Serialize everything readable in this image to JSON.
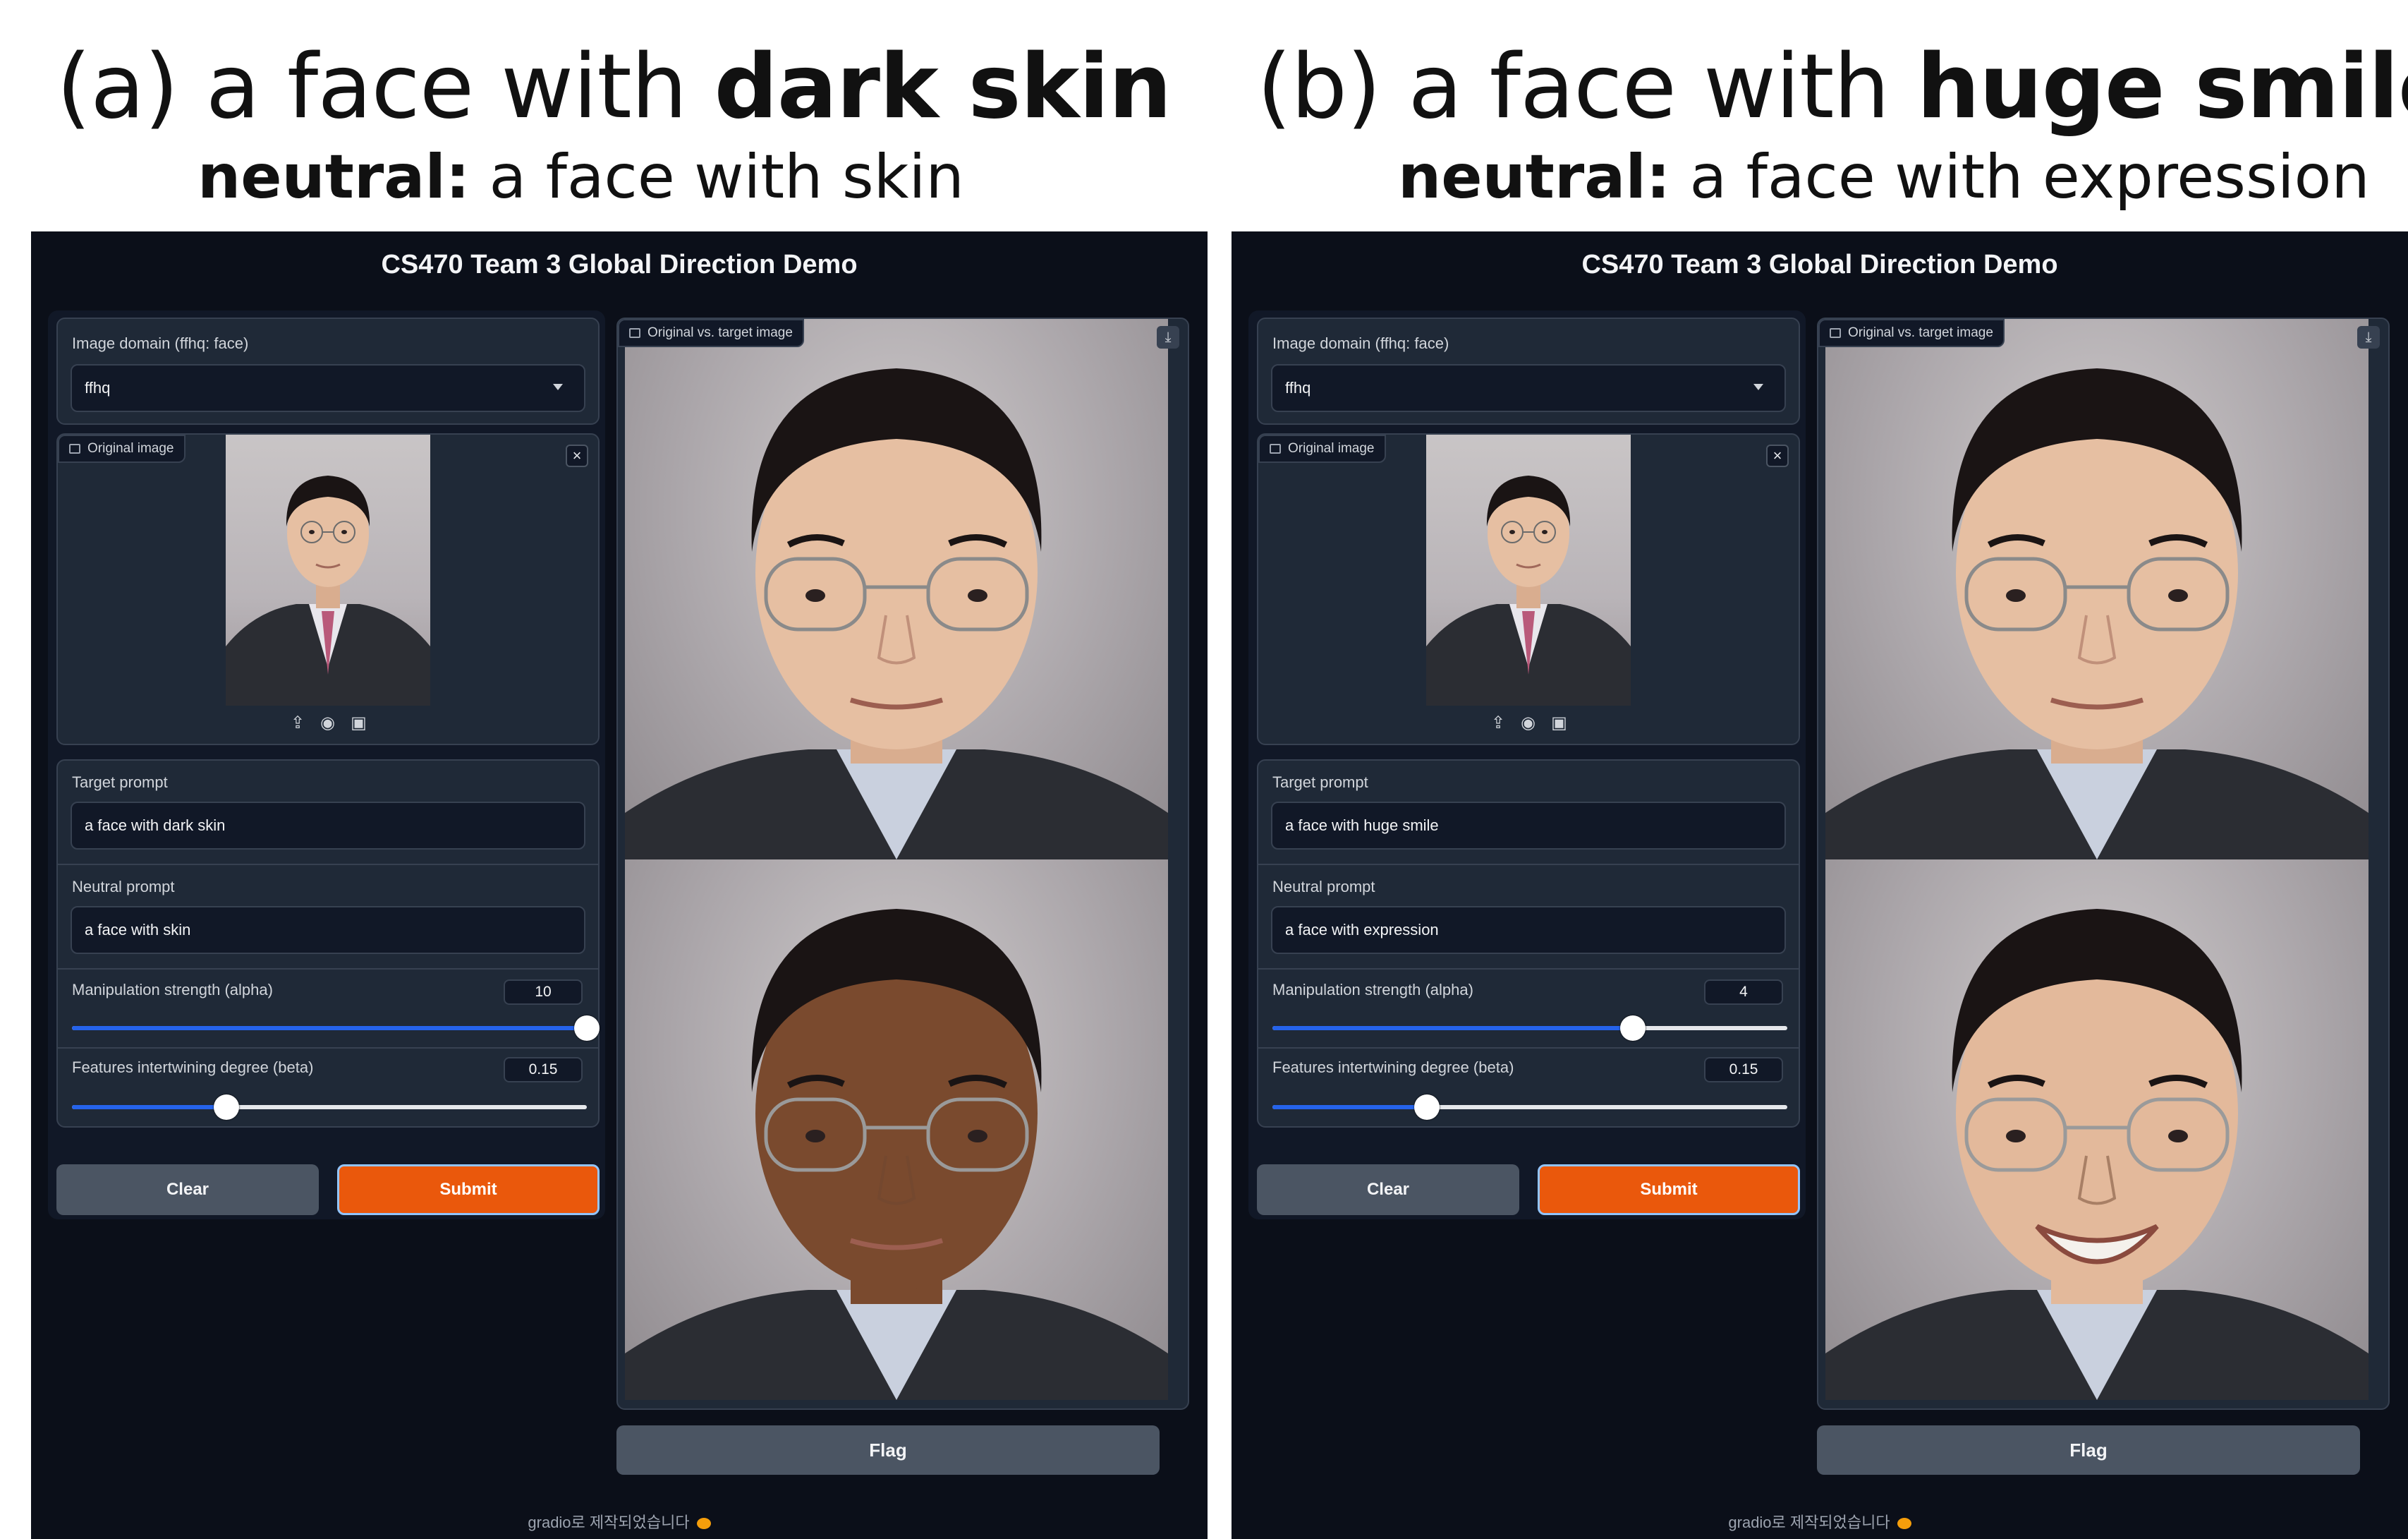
{
  "panels": [
    {
      "caption_prefix": "(a) a face with ",
      "caption_bold": "dark skin",
      "neutral_bold": "neutral:",
      "neutral_text": " a face with skin",
      "app_title": "CS470 Team 3 Global Direction Demo",
      "domain_label": "Image domain (ffhq: face)",
      "domain_value": "ffhq",
      "original_image_label": "Original image",
      "target_prompt_label": "Target prompt",
      "target_prompt_value": "a face with dark skin",
      "neutral_prompt_label": "Neutral prompt",
      "neutral_prompt_value": "a face with skin",
      "alpha_label": "Manipulation strength (alpha)",
      "alpha_value": "10",
      "alpha_fraction": 1.0,
      "beta_label": "Features intertwining degree (beta)",
      "beta_value": "0.15",
      "beta_fraction": 0.3,
      "clear_label": "Clear",
      "submit_label": "Submit",
      "output_label": "Original vs. target image",
      "flag_label": "Flag",
      "footer": "gradio로 제작되었습니다",
      "target_skin_color": "#7a4a2e"
    },
    {
      "caption_prefix": "(b) a face with ",
      "caption_bold": "huge smile",
      "neutral_bold": "neutral:",
      "neutral_text": " a face with expression",
      "app_title": "CS470 Team 3 Global Direction Demo",
      "domain_label": "Image domain (ffhq: face)",
      "domain_value": "ffhq",
      "original_image_label": "Original image",
      "target_prompt_label": "Target prompt",
      "target_prompt_value": "a face with huge smile",
      "neutral_prompt_label": "Neutral prompt",
      "neutral_prompt_value": "a face with expression",
      "alpha_label": "Manipulation strength (alpha)",
      "alpha_value": "4",
      "alpha_fraction": 0.7,
      "beta_label": "Features intertwining degree (beta)",
      "beta_value": "0.15",
      "beta_fraction": 0.3,
      "clear_label": "Clear",
      "submit_label": "Submit",
      "output_label": "Original vs. target image",
      "flag_label": "Flag",
      "footer": "gradio로 제작되었습니다",
      "target_skin_color": "#e3b99b"
    }
  ],
  "colors": {
    "app_bg": "#0b0f19",
    "panel_bg": "#1f2937",
    "accent_blue": "#2563eb",
    "submit_orange": "#ea580c",
    "original_skin": "#e6bfa2",
    "hair": "#1a1414",
    "suit": "#2b2d33"
  },
  "icons": [
    "image-icon",
    "close-icon",
    "upload-icon",
    "webcam-icon",
    "clipboard-icon",
    "download-icon",
    "chevron-down-icon"
  ]
}
